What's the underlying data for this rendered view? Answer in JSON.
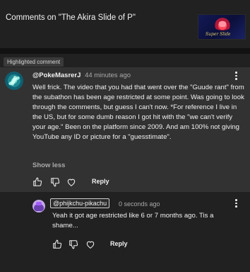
{
  "header": {
    "title": "Comments on \"The Akira Slide of P\"",
    "thumbnail_caption": "Super Slide"
  },
  "highlight": {
    "badge": "Highlighted comment"
  },
  "comment": {
    "author": "@PokeMasrerJ",
    "timestamp": "44 minutes ago",
    "body": "Well frick. The video that you had that went over the \"Guude rant\" from the subathon has been age restricted at some point. Was going to look through the comments,  but guess I can't now. *For reference I live in the US, but for some dumb reason I got hit with the \"we can't verify your age.\" Been on the platform since 2009. And am 100% not giving YouTube any ID or picture for a \"guesstimate\".",
    "show_less": "Show less",
    "reply_label": "Reply"
  },
  "reply": {
    "mention": "@phijkchu-pikachu",
    "timestamp": "0 seconds ago",
    "body": "Yeah it got age restricted like 6 or 7 months ago. Tis a shame...",
    "reply_label": "Reply"
  },
  "icons": {
    "like": "thumbs-up-icon",
    "dislike": "thumbs-down-icon",
    "heart": "heart-icon",
    "more": "more-vert-icon"
  },
  "colors": {
    "background": "#212121",
    "highlight_panel": "#323232",
    "text_primary": "#f1f1f1",
    "text_secondary": "#aaaaaa"
  }
}
